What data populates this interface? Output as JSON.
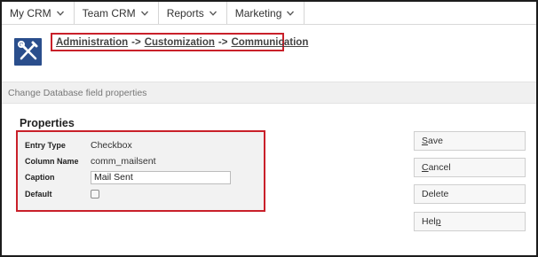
{
  "nav": {
    "items": [
      {
        "label": "My CRM"
      },
      {
        "label": "Team CRM"
      },
      {
        "label": "Reports"
      },
      {
        "label": "Marketing"
      }
    ]
  },
  "breadcrumb": {
    "items": [
      "Administration",
      "Customization",
      "Communication"
    ],
    "separator": "->"
  },
  "header": {
    "title": "Change Database field properties"
  },
  "properties": {
    "title": "Properties",
    "fields": {
      "entry_type": {
        "label": "Entry Type",
        "value": "Checkbox"
      },
      "column_name": {
        "label": "Column Name",
        "value": "comm_mailsent"
      },
      "caption": {
        "label": "Caption",
        "value": "Mail Sent"
      },
      "default": {
        "label": "Default",
        "checked": false
      }
    }
  },
  "actions": {
    "save": {
      "first": "S",
      "rest": "ave"
    },
    "cancel": {
      "first": "C",
      "rest": "ancel"
    },
    "delete": {
      "label": "Delete"
    },
    "help": {
      "pre": "Hel",
      "ul": "p"
    }
  },
  "colors": {
    "highlight_border": "#c9202a",
    "logo_bg": "#2a4e8c",
    "panel_bg": "#f2f2f2"
  },
  "icons": {
    "nav_dropdown": "chevron-down-icon",
    "logo": "tools-icon"
  }
}
